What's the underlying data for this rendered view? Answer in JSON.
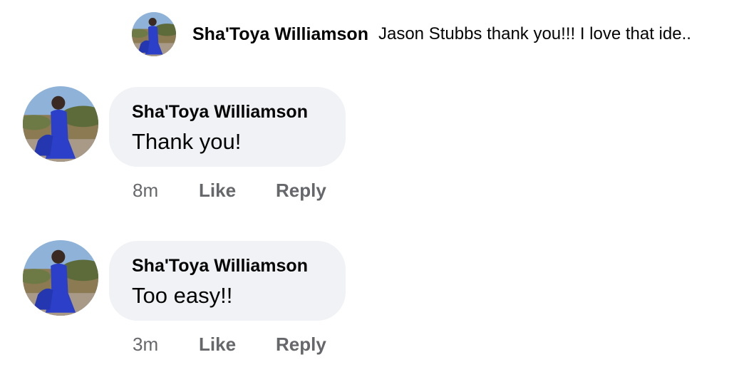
{
  "preview_reply": {
    "author": "Sha'Toya Williamson",
    "text": "Jason Stubbs thank you!!! I love that ide.."
  },
  "comments": [
    {
      "author": "Sha'Toya Williamson",
      "text": "Thank you!",
      "time": "8m",
      "like_label": "Like",
      "reply_label": "Reply"
    },
    {
      "author": "Sha'Toya Williamson",
      "text": "Too easy!!",
      "time": "3m",
      "like_label": "Like",
      "reply_label": "Reply"
    }
  ],
  "colors": {
    "bubble_bg": "#f0f2f5",
    "text_primary": "#050505",
    "text_secondary": "#65676b"
  }
}
